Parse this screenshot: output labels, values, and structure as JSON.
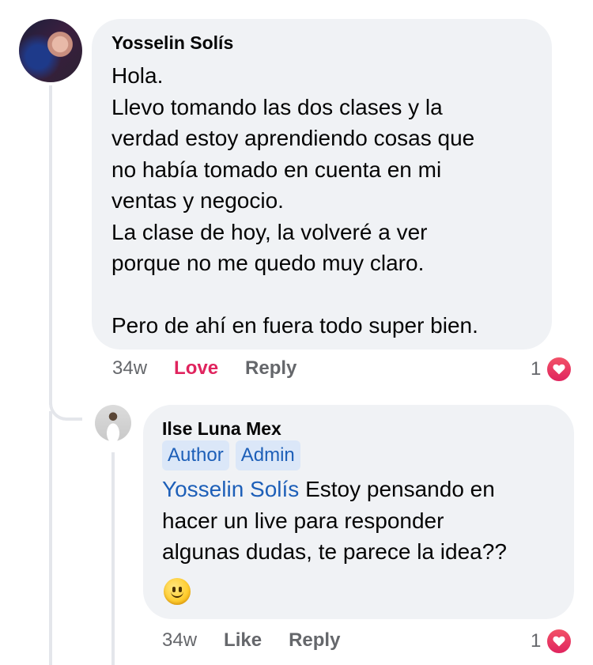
{
  "comment": {
    "author": "Yosselin Solís",
    "text_lines": [
      "Hola.",
      "Llevo tomando las dos clases y la",
      "verdad estoy aprendiendo cosas que",
      "no había tomado en cuenta en mi",
      "ventas y negocio.",
      "La clase de hoy, la volveré a ver",
      "porque no me quedo muy claro.",
      "",
      "Pero de ahí en fuera todo super bien."
    ],
    "time": "34w",
    "reaction_action": "Love",
    "reply_label": "Reply",
    "reaction_count": "1",
    "reaction_icon": "heart-icon",
    "reaction_color": "#e0245e"
  },
  "reply": {
    "author": "Ilse Luna Mex",
    "badges": [
      "Author",
      "Admin"
    ],
    "mention": "Yosselin Solís",
    "text_lines": [
      " Estoy pensando en",
      "hacer un live para responder",
      "algunas dudas, te parece la idea??"
    ],
    "emoji": "slightly-smiling-face-icon",
    "time": "34w",
    "like_label": "Like",
    "reply_label": "Reply",
    "reaction_count": "1",
    "reaction_icon": "heart-icon"
  },
  "colors": {
    "bubble": "#f0f2f5",
    "link_blue": "#1d5fb8",
    "badge_bg": "#dbe7f8",
    "muted": "#65676b"
  }
}
